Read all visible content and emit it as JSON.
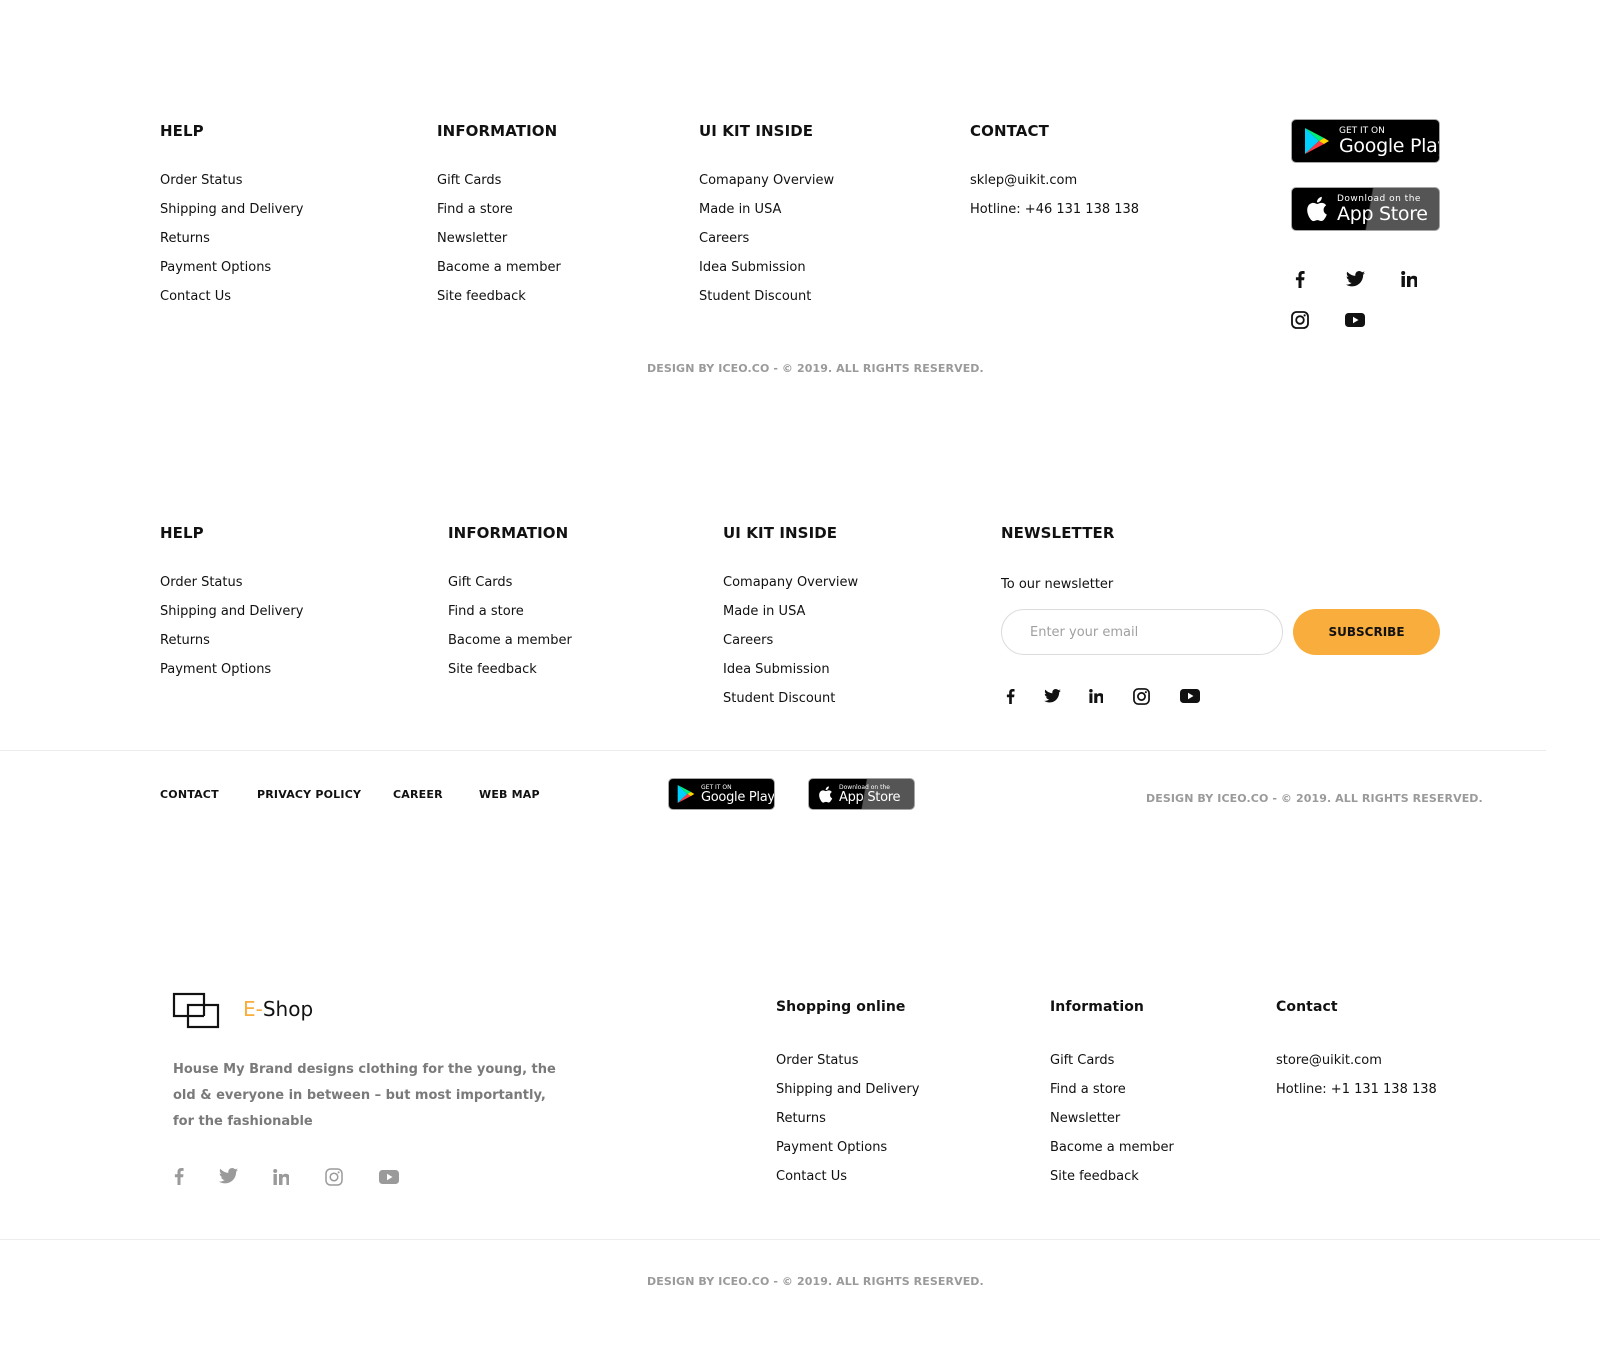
{
  "footer1": {
    "help": {
      "title": "HELP",
      "items": [
        "Order Status",
        "Shipping and Delivery",
        "Returns",
        "Payment Options",
        "Contact Us"
      ]
    },
    "information": {
      "title": "INFORMATION",
      "items": [
        "Gift Cards",
        "Find a store",
        "Newsletter",
        "Bacome a member",
        "Site feedback"
      ]
    },
    "uikit": {
      "title": "UI KIT INSIDE",
      "items": [
        "Comapany Overview",
        "Made in USA",
        "Careers",
        "Idea Submission",
        "Student Discount"
      ]
    },
    "contact": {
      "title": "CONTACT",
      "email": "sklep@uikit.com",
      "hotline": "Hotline: +46 131 138 138"
    },
    "google_play": {
      "small": "GET IT ON",
      "big": "Google Play"
    },
    "app_store": {
      "small": "Download on the",
      "big": "App Store"
    },
    "social_icons": [
      "facebook-icon",
      "twitter-icon",
      "linkedin-icon",
      "instagram-icon",
      "youtube-icon"
    ],
    "copyright": "DESIGN BY ICEO.CO - © 2019. ALL RIGHTS RESERVED."
  },
  "footer2": {
    "help": {
      "title": "HELP",
      "items": [
        "Order Status",
        "Shipping and Delivery",
        "Returns",
        "Payment Options"
      ]
    },
    "information": {
      "title": "INFORMATION",
      "items": [
        "Gift Cards",
        "Find a store",
        "Bacome a member",
        "Site feedback"
      ]
    },
    "uikit": {
      "title": "UI KIT INSIDE",
      "items": [
        "Comapany Overview",
        "Made in USA",
        "Careers",
        "Idea Submission",
        "Student Discount"
      ]
    },
    "newsletter": {
      "title": "NEWSLETTER",
      "subtitle": "To our newsletter",
      "placeholder": "Enter your email",
      "button": "SUBSCRIBE"
    },
    "bottom_links": [
      "CONTACT",
      "PRIVACY POLICY",
      "CAREER",
      "WEB MAP"
    ],
    "google_play": {
      "small": "GET IT ON",
      "big": "Google Play"
    },
    "app_store": {
      "small": "Download on the",
      "big": "App Store"
    },
    "copyright": "DESIGN BY ICEO.CO - © 2019. ALL RIGHTS RESERVED."
  },
  "footer3": {
    "brand": {
      "prefix": "E-",
      "name": "Shop",
      "accent_color": "#f8ad3d"
    },
    "description": "House My Brand designs clothing for the young, the old & everyone in between – but most importantly, for the fashionable",
    "shopping": {
      "title": "Shopping online",
      "items": [
        "Order Status",
        "Shipping and Delivery",
        "Returns",
        "Payment Options",
        "Contact Us"
      ]
    },
    "information": {
      "title": "Information",
      "items": [
        "Gift Cards",
        "Find a store",
        "Newsletter",
        "Bacome a member",
        "Site feedback"
      ]
    },
    "contact": {
      "title": "Contact",
      "email": "store@uikit.com",
      "hotline": "Hotline: +1 131 138 138"
    },
    "copyright": "DESIGN BY ICEO.CO - © 2019. ALL RIGHTS RESERVED."
  },
  "colors": {
    "accent": "#f8ad3d",
    "muted_text": "#9a9a9a",
    "divider": "#ececec"
  }
}
